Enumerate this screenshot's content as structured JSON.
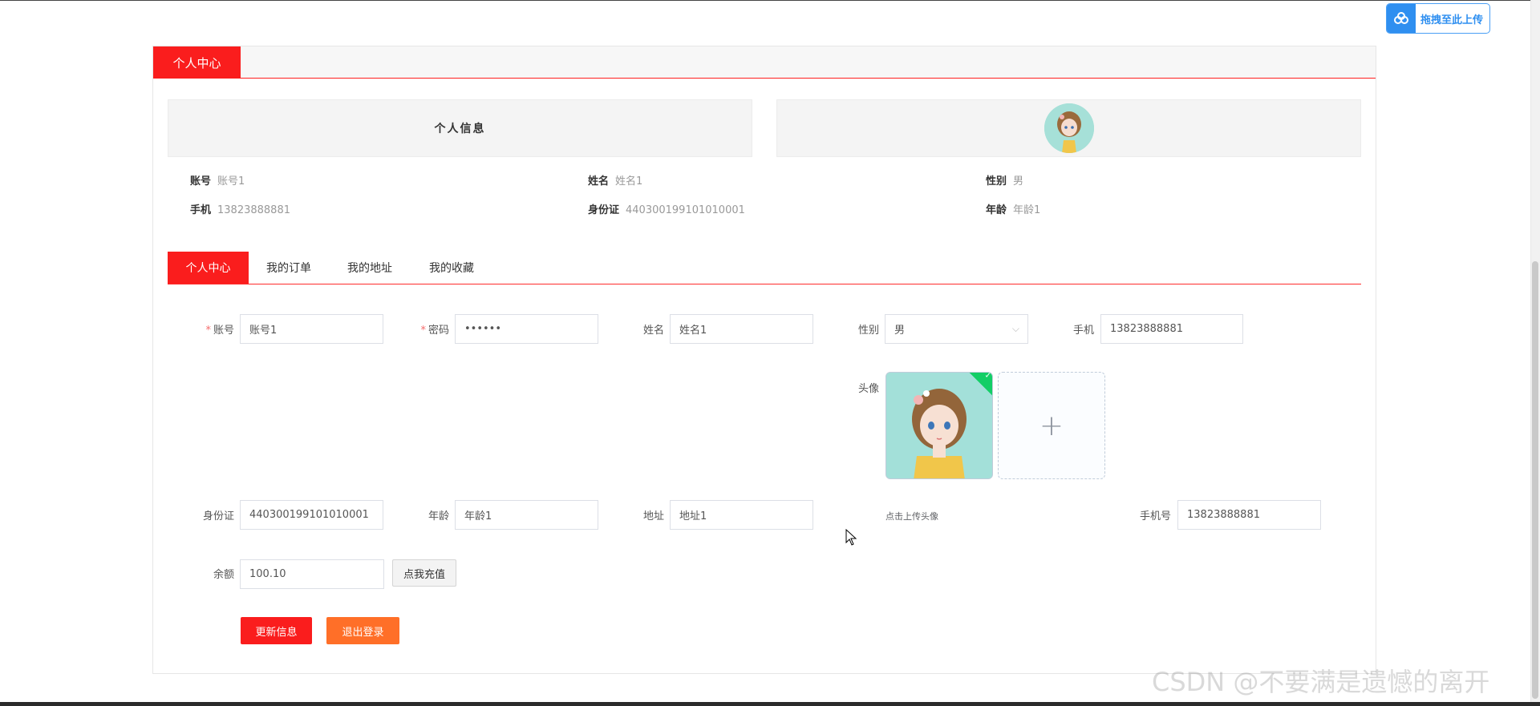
{
  "float_upload": {
    "label": "拖拽至此上传",
    "icon": "cloud-upload-icon"
  },
  "panel": {
    "tab_label": "个人中心"
  },
  "info": {
    "title": "个人信息",
    "account_key": "账号",
    "account_val": "账号1",
    "name_key": "姓名",
    "name_val": "姓名1",
    "gender_key": "性别",
    "gender_val": "男",
    "phone_key": "手机",
    "phone_val": "13823888881",
    "id_key": "身份证",
    "id_val": "440300199101010001",
    "age_key": "年龄",
    "age_val": "年龄1"
  },
  "tabs": [
    {
      "label": "个人中心",
      "active": true
    },
    {
      "label": "我的订单",
      "active": false
    },
    {
      "label": "我的地址",
      "active": false
    },
    {
      "label": "我的收藏",
      "active": false
    }
  ],
  "form": {
    "account": {
      "label": "账号",
      "value": "账号1"
    },
    "password": {
      "label": "密码",
      "value": "••••••"
    },
    "name": {
      "label": "姓名",
      "value": "姓名1"
    },
    "gender": {
      "label": "性别",
      "value": "男"
    },
    "phone": {
      "label": "手机",
      "value": "13823888881"
    },
    "avatar": {
      "label": "头像",
      "hint": "点击上传头像"
    },
    "id_card": {
      "label": "身份证",
      "value": "440300199101010001"
    },
    "age": {
      "label": "年龄",
      "value": "年龄1"
    },
    "address": {
      "label": "地址",
      "value": "地址1"
    },
    "mobile": {
      "label": "手机号",
      "value": "13823888881"
    },
    "balance": {
      "label": "余额",
      "value": "100.10"
    },
    "recharge_label": "点我充值",
    "update_label": "更新信息",
    "logout_label": "退出登录"
  },
  "colors": {
    "primary": "#fa1d1d",
    "orange": "#ff6f28",
    "success": "#13ce66"
  },
  "watermark": "CSDN @不要满是遗憾的离开"
}
